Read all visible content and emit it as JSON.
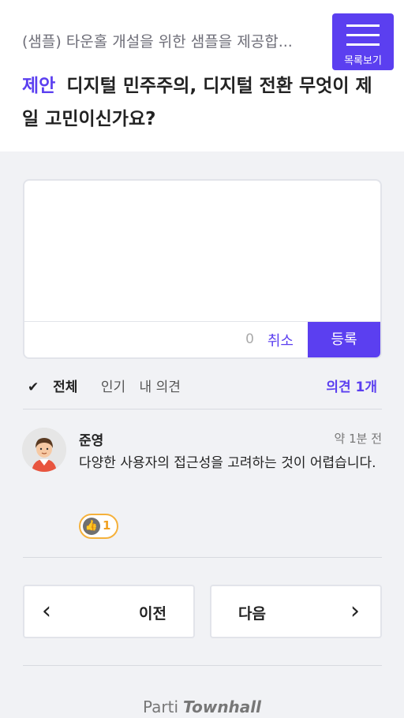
{
  "header": {
    "event_title": "(샘플) 타운홀 개설을 위한 샘플을 제공합...",
    "menu_label": "목록보기",
    "question_tag": "제안",
    "question_text": "디지털 민주주의, 디지털 전환 무엇이 제일 고민이신가요?"
  },
  "editor": {
    "placeholder": "",
    "char_count": "0",
    "cancel_label": "취소",
    "submit_label": "등록"
  },
  "filters": {
    "items": [
      "전체",
      "인기",
      "내 의견"
    ],
    "active": "전체",
    "count_label": "의견 1개"
  },
  "comment": {
    "author": "준영",
    "time": "약 1분 전",
    "text": "다양한 사용자의 접근성을 고려하는 것이 어렵습니다.",
    "like_count": "1"
  },
  "nav": {
    "prev_label": "이전",
    "next_label": "다음"
  },
  "footer": {
    "brand_a": "Parti",
    "brand_b": "Townhall"
  },
  "colors": {
    "accent": "#5b3ff0",
    "like": "#f5b13b"
  }
}
